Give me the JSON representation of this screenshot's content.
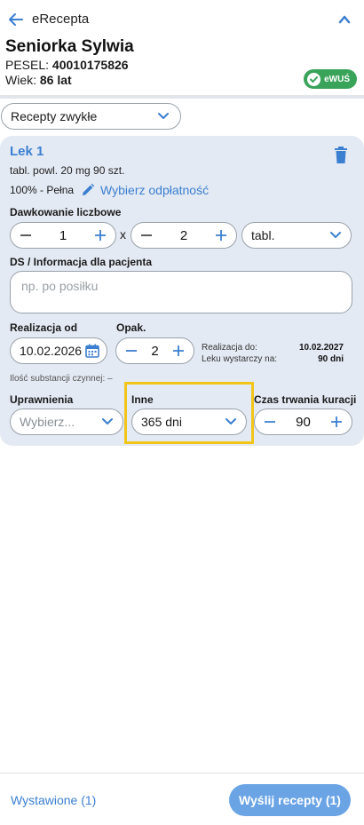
{
  "header": {
    "title": "eRecepta",
    "patient_name": "Seniorka Sylwia",
    "pesel_label": "PESEL:",
    "pesel_value": "40010175826",
    "age_label": "Wiek:",
    "age_value": "86 lat",
    "ewus_badge": "eWUŚ"
  },
  "prescription_type": "Recepty zwykłe",
  "drug": {
    "title": "Lek 1",
    "description": "tabl. powl. 20 mg 90 szt.",
    "refund_level": "100% - Pełna",
    "refund_link": "Wybierz odpłatność"
  },
  "dosage": {
    "label": "Dawkowanie liczbowe",
    "amount": "1",
    "multiplier": "x",
    "times": "2",
    "unit": "tabl."
  },
  "ds": {
    "label": "DS / Informacja dla pacjenta",
    "placeholder": "np. po posiłku"
  },
  "realization": {
    "label": "Realizacja od",
    "date": "10.02.2026",
    "package_label": "Opak.",
    "package_count": "2",
    "until_label": "Realizacja do:",
    "until_value": "10.02.2027",
    "enough_label": "Leku wystarczy na:",
    "enough_value": "90 dni"
  },
  "substance_text": "Ilość substancji czynnej: –",
  "permissions": {
    "label": "Uprawnienia",
    "placeholder": "Wybierz..."
  },
  "other": {
    "label": "Inne",
    "value": "365 dni"
  },
  "duration": {
    "label": "Czas trwania kuracji",
    "value": "90"
  },
  "footer": {
    "issued_link": "Wystawione (1)",
    "send_button": "Wyślij recepty (1)"
  },
  "colors": {
    "accent": "#3b7fd1",
    "card_bg": "#e4eaf3",
    "ewus_green": "#3aa35a",
    "highlight": "#f2c51b",
    "send_button": "#6aa4e5"
  }
}
